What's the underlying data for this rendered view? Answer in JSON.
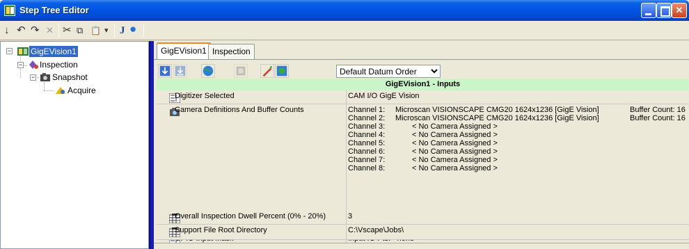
{
  "window": {
    "title": "Step Tree Editor",
    "minimize_label": "_",
    "maximize_label": "□",
    "close_label": "✕"
  },
  "toolbar": {
    "items": [
      {
        "name": "down-arrow-icon",
        "glyph": "↓"
      },
      {
        "name": "undo-icon",
        "glyph": "↶"
      },
      {
        "name": "redo-icon",
        "glyph": "↷"
      },
      {
        "name": "delete-icon",
        "glyph": "✕"
      },
      {
        "name": "cut-icon",
        "glyph": "✂"
      },
      {
        "name": "copy-icon",
        "glyph": "⧉"
      },
      {
        "name": "paste-icon",
        "glyph": "📋"
      },
      {
        "name": "dropdown-arrow-icon",
        "glyph": "▾"
      },
      {
        "name": "java-icon",
        "glyph": "J"
      },
      {
        "name": "globe-icon",
        "glyph": "●"
      }
    ]
  },
  "tree": {
    "nodes": [
      {
        "label": "GigEVision1",
        "expander": "−",
        "selected": true
      },
      {
        "label": "Inspection",
        "expander": "−"
      },
      {
        "label": "Snapshot",
        "expander": "−"
      },
      {
        "label": "Acquire"
      }
    ]
  },
  "tabs": [
    {
      "label": "GigEVision1",
      "active": true
    },
    {
      "label": "Inspection",
      "active": false
    }
  ],
  "datum_order": {
    "selected": "Default Datum Order"
  },
  "section_title": "GigEVision1 - Inputs",
  "properties": {
    "digitizer": {
      "name": "Digitizer Selected",
      "value": "CAM I/O GigE Vision"
    },
    "cameras": {
      "name": "Camera Definitions And Buffer Counts",
      "channels": [
        {
          "label": "Channel 1:",
          "camera": "Microscan VISIONSCAPE CMG20 1624x1236 [GigE Vision]",
          "buffer": "Buffer Count: 16"
        },
        {
          "label": "Channel 2:",
          "camera": "Microscan VISIONSCAPE CMG20 1624x1236 [GigE Vision]",
          "buffer": "Buffer Count: 16"
        },
        {
          "label": "Channel 3:",
          "none": "< No Camera Assigned >"
        },
        {
          "label": "Channel 4:",
          "none": "< No Camera Assigned >"
        },
        {
          "label": "Channel 5:",
          "none": "< No Camera Assigned >"
        },
        {
          "label": "Channel 6:",
          "none": "< No Camera Assigned >"
        },
        {
          "label": "Channel 7:",
          "none": "< No Camera Assigned >"
        },
        {
          "label": "Channel 8:",
          "none": "< No Camera Assigned >"
        }
      ]
    },
    "gpio": {
      "name": "GPIO Input Mask",
      "value": "Input IO Pts: <none>"
    },
    "dwell": {
      "name": "Overall Inspection Dwell Percent (0% - 20%)",
      "value": "3"
    },
    "support": {
      "name": "Support File Root Directory",
      "value": "C:\\Vscape\\Jobs\\"
    }
  },
  "colors": {
    "titlebar": "#0055e5",
    "selection": "#316ac5",
    "section_header": "#c9f5c9",
    "splitter": "#1a1ab8"
  }
}
